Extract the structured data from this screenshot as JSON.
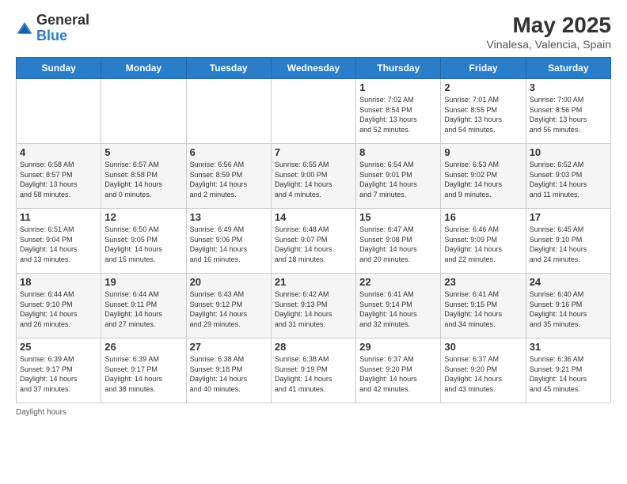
{
  "logo": {
    "general": "General",
    "blue": "Blue"
  },
  "header": {
    "month_year": "May 2025",
    "location": "Vinalesa, Valencia, Spain"
  },
  "weekdays": [
    "Sunday",
    "Monday",
    "Tuesday",
    "Wednesday",
    "Thursday",
    "Friday",
    "Saturday"
  ],
  "weeks": [
    [
      {
        "day": "",
        "info": ""
      },
      {
        "day": "",
        "info": ""
      },
      {
        "day": "",
        "info": ""
      },
      {
        "day": "",
        "info": ""
      },
      {
        "day": "1",
        "info": "Sunrise: 7:02 AM\nSunset: 8:54 PM\nDaylight: 13 hours\nand 52 minutes."
      },
      {
        "day": "2",
        "info": "Sunrise: 7:01 AM\nSunset: 8:55 PM\nDaylight: 13 hours\nand 54 minutes."
      },
      {
        "day": "3",
        "info": "Sunrise: 7:00 AM\nSunset: 8:56 PM\nDaylight: 13 hours\nand 56 minutes."
      }
    ],
    [
      {
        "day": "4",
        "info": "Sunrise: 6:58 AM\nSunset: 8:57 PM\nDaylight: 13 hours\nand 58 minutes."
      },
      {
        "day": "5",
        "info": "Sunrise: 6:57 AM\nSunset: 8:58 PM\nDaylight: 14 hours\nand 0 minutes."
      },
      {
        "day": "6",
        "info": "Sunrise: 6:56 AM\nSunset: 8:59 PM\nDaylight: 14 hours\nand 2 minutes."
      },
      {
        "day": "7",
        "info": "Sunrise: 6:55 AM\nSunset: 9:00 PM\nDaylight: 14 hours\nand 4 minutes."
      },
      {
        "day": "8",
        "info": "Sunrise: 6:54 AM\nSunset: 9:01 PM\nDaylight: 14 hours\nand 7 minutes."
      },
      {
        "day": "9",
        "info": "Sunrise: 6:53 AM\nSunset: 9:02 PM\nDaylight: 14 hours\nand 9 minutes."
      },
      {
        "day": "10",
        "info": "Sunrise: 6:52 AM\nSunset: 9:03 PM\nDaylight: 14 hours\nand 11 minutes."
      }
    ],
    [
      {
        "day": "11",
        "info": "Sunrise: 6:51 AM\nSunset: 9:04 PM\nDaylight: 14 hours\nand 13 minutes."
      },
      {
        "day": "12",
        "info": "Sunrise: 6:50 AM\nSunset: 9:05 PM\nDaylight: 14 hours\nand 15 minutes."
      },
      {
        "day": "13",
        "info": "Sunrise: 6:49 AM\nSunset: 9:06 PM\nDaylight: 14 hours\nand 16 minutes."
      },
      {
        "day": "14",
        "info": "Sunrise: 6:48 AM\nSunset: 9:07 PM\nDaylight: 14 hours\nand 18 minutes."
      },
      {
        "day": "15",
        "info": "Sunrise: 6:47 AM\nSunset: 9:08 PM\nDaylight: 14 hours\nand 20 minutes."
      },
      {
        "day": "16",
        "info": "Sunrise: 6:46 AM\nSunset: 9:09 PM\nDaylight: 14 hours\nand 22 minutes."
      },
      {
        "day": "17",
        "info": "Sunrise: 6:45 AM\nSunset: 9:10 PM\nDaylight: 14 hours\nand 24 minutes."
      }
    ],
    [
      {
        "day": "18",
        "info": "Sunrise: 6:44 AM\nSunset: 9:10 PM\nDaylight: 14 hours\nand 26 minutes."
      },
      {
        "day": "19",
        "info": "Sunrise: 6:44 AM\nSunset: 9:11 PM\nDaylight: 14 hours\nand 27 minutes."
      },
      {
        "day": "20",
        "info": "Sunrise: 6:43 AM\nSunset: 9:12 PM\nDaylight: 14 hours\nand 29 minutes."
      },
      {
        "day": "21",
        "info": "Sunrise: 6:42 AM\nSunset: 9:13 PM\nDaylight: 14 hours\nand 31 minutes."
      },
      {
        "day": "22",
        "info": "Sunrise: 6:41 AM\nSunset: 9:14 PM\nDaylight: 14 hours\nand 32 minutes."
      },
      {
        "day": "23",
        "info": "Sunrise: 6:41 AM\nSunset: 9:15 PM\nDaylight: 14 hours\nand 34 minutes."
      },
      {
        "day": "24",
        "info": "Sunrise: 6:40 AM\nSunset: 9:16 PM\nDaylight: 14 hours\nand 35 minutes."
      }
    ],
    [
      {
        "day": "25",
        "info": "Sunrise: 6:39 AM\nSunset: 9:17 PM\nDaylight: 14 hours\nand 37 minutes."
      },
      {
        "day": "26",
        "info": "Sunrise: 6:39 AM\nSunset: 9:17 PM\nDaylight: 14 hours\nand 38 minutes."
      },
      {
        "day": "27",
        "info": "Sunrise: 6:38 AM\nSunset: 9:18 PM\nDaylight: 14 hours\nand 40 minutes."
      },
      {
        "day": "28",
        "info": "Sunrise: 6:38 AM\nSunset: 9:19 PM\nDaylight: 14 hours\nand 41 minutes."
      },
      {
        "day": "29",
        "info": "Sunrise: 6:37 AM\nSunset: 9:20 PM\nDaylight: 14 hours\nand 42 minutes."
      },
      {
        "day": "30",
        "info": "Sunrise: 6:37 AM\nSunset: 9:20 PM\nDaylight: 14 hours\nand 43 minutes."
      },
      {
        "day": "31",
        "info": "Sunrise: 6:36 AM\nSunset: 9:21 PM\nDaylight: 14 hours\nand 45 minutes."
      }
    ]
  ],
  "footer": {
    "daylight_label": "Daylight hours"
  }
}
